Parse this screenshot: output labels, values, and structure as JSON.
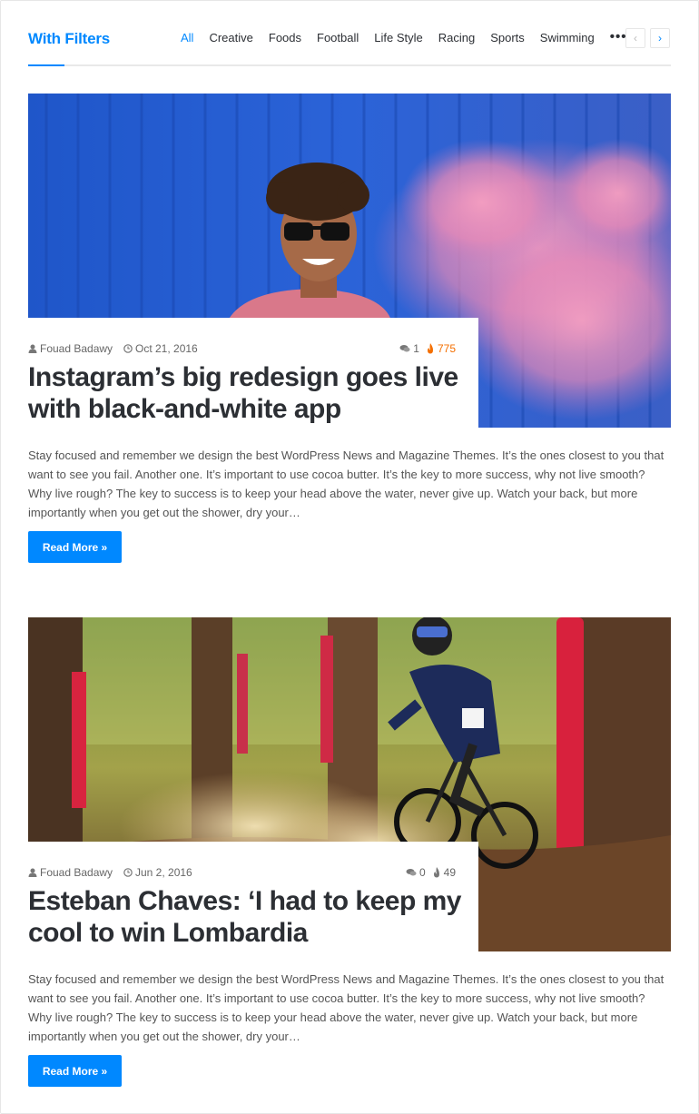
{
  "block": {
    "title": "With Filters",
    "filters": [
      "All",
      "Creative",
      "Foods",
      "Football",
      "Life Style",
      "Racing",
      "Sports",
      "Swimming"
    ],
    "more_label": "•••",
    "prev_label": "‹",
    "next_label": "›"
  },
  "posts": [
    {
      "author": "Fouad Badawy",
      "date": "Oct 21, 2016",
      "comments": "1",
      "views": "775",
      "title": "Instagram’s big redesign goes live with black-and-white app",
      "excerpt": "Stay focused and remember we design the best WordPress News and Magazine Themes. It’s the ones closest to you that want to see you fail. Another one. It’s important to use cocoa butter. It’s the key to more success, why not live smooth? Why live rough? The key to success is to keep your head above the water, never give up. Watch your back, but more importantly when you get out the shower, dry your…",
      "read_more": "Read More »"
    },
    {
      "author": "Fouad Badawy",
      "date": "Jun 2, 2016",
      "comments": "0",
      "views": "49",
      "title": "Esteban Chaves: ‘I had to keep my cool to win Lombardia",
      "excerpt": "Stay focused and remember we design the best WordPress News and Magazine Themes. It’s the ones closest to you that want to see you fail. Another one. It’s important to use cocoa butter. It’s the key to more success, why not live smooth? Why live rough? The key to success is to keep your head above the water, never give up. Watch your back, but more importantly when you get out the shower, dry your…",
      "read_more": "Read More »"
    }
  ],
  "colors": {
    "accent": "#0088ff",
    "views": "#f46f00",
    "text": "#2c2f34"
  },
  "icons": [
    "user-icon",
    "clock-icon",
    "comments-icon",
    "fire-icon"
  ]
}
